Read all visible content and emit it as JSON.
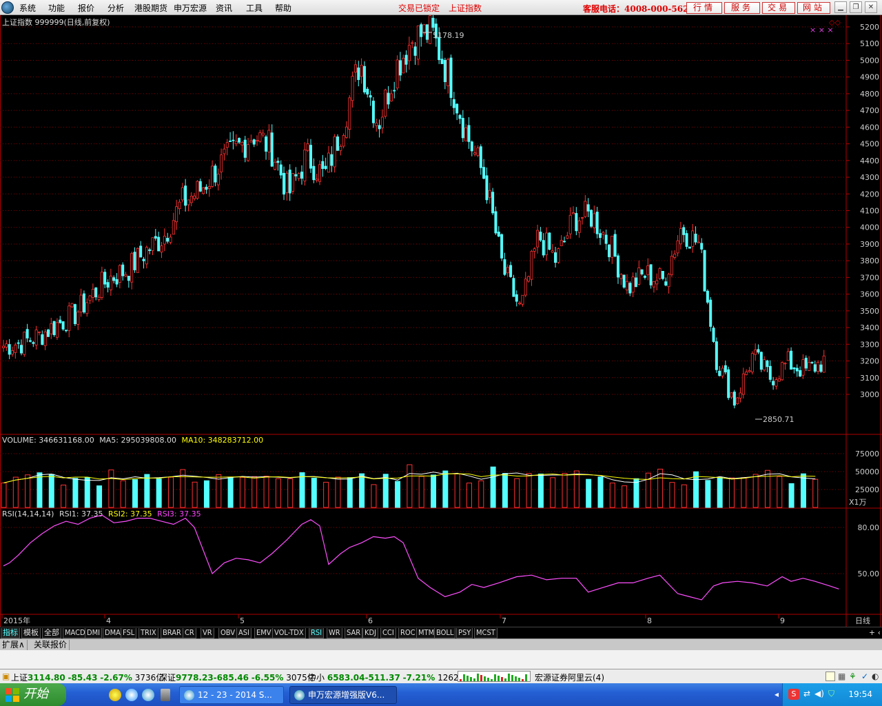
{
  "menu": {
    "items": [
      "系统",
      "功能",
      "报价",
      "分析",
      "港股期货",
      "申万宏源",
      "资讯",
      "工具",
      "帮助"
    ],
    "status1": "交易已锁定",
    "status2": "上证指数",
    "service_phone": "客服电话：4008-000-562",
    "buttons": [
      "行情",
      "服务",
      "交易",
      "网站"
    ]
  },
  "chart_data": [
    {
      "type": "candlestick",
      "title": "上证指数 999999(日线,前复权)",
      "ylim": [
        2800,
        5250
      ],
      "yticks": [
        3000,
        3100,
        3200,
        3300,
        3400,
        3500,
        3600,
        3700,
        3800,
        3900,
        4000,
        4100,
        4200,
        4300,
        4400,
        4500,
        4600,
        4700,
        4800,
        4900,
        5000,
        5100,
        5200
      ],
      "high_label": "5178.19",
      "low_label": "2850.71",
      "x_labels": [
        "2015年",
        "4",
        "5",
        "6",
        "7",
        "8",
        "9"
      ],
      "period_label": "日线",
      "anchors": [
        [
          3290,
          3290
        ],
        [
          3300,
          3310
        ],
        [
          3330,
          3350
        ],
        [
          3390,
          3420
        ],
        [
          3500,
          3480
        ],
        [
          3580,
          3600
        ],
        [
          3650,
          3700
        ],
        [
          3690,
          3750
        ],
        [
          3800,
          3860
        ],
        [
          3920,
          3950
        ],
        [
          4080,
          4150
        ],
        [
          4170,
          4220
        ],
        [
          4290,
          4360
        ],
        [
          4400,
          4460
        ],
        [
          4530,
          4560
        ],
        [
          4420,
          4480
        ],
        [
          4120,
          4200
        ],
        [
          4400,
          4430
        ],
        [
          4300,
          4300
        ],
        [
          4560,
          4610
        ],
        [
          4960,
          5000
        ],
        [
          4630,
          4620
        ],
        [
          4900,
          4960
        ],
        [
          5130,
          5140
        ],
        [
          5140,
          5170
        ],
        [
          4900,
          4900
        ],
        [
          4480,
          4550
        ],
        [
          4180,
          4290
        ],
        [
          3690,
          3750
        ],
        [
          3510,
          3500
        ],
        [
          3890,
          3950
        ],
        [
          3760,
          3800
        ],
        [
          4040,
          4060
        ],
        [
          3990,
          4070
        ],
        [
          4000,
          3900
        ],
        [
          3720,
          3640
        ],
        [
          3760,
          3720
        ],
        [
          3680,
          3680
        ],
        [
          3980,
          4000
        ],
        [
          3980,
          3900
        ],
        [
          3280,
          3200
        ],
        [
          3000,
          2960
        ],
        [
          3020,
          3230
        ],
        [
          3060,
          3100
        ],
        [
          3160,
          3190
        ],
        [
          3160,
          3140
        ],
        [
          3200,
          3200
        ]
      ],
      "volume": {
        "label": "VOLUME: 346631168.00",
        "ma5": "MA5: 295039808.00",
        "ma10": "MA10: 348283712.00",
        "yticks": [
          25000,
          50000,
          75000
        ],
        "unit": "X1万"
      },
      "rsi": {
        "label": "RSI(14,14,14)",
        "rsi1": "RSI1: 37.35",
        "rsi2": "RSI2: 37.35",
        "rsi3": "RSI3: 37.35",
        "yticks": [
          50,
          80
        ],
        "anchors": [
          [
            0,
            55
          ],
          [
            2,
            57
          ],
          [
            5,
            62
          ],
          [
            9,
            70
          ],
          [
            13,
            76
          ],
          [
            17,
            81
          ],
          [
            21,
            84
          ],
          [
            25,
            82
          ],
          [
            29,
            86
          ],
          [
            33,
            88
          ],
          [
            37,
            83
          ],
          [
            41,
            84
          ],
          [
            45,
            86
          ],
          [
            49,
            86
          ],
          [
            53,
            84
          ],
          [
            57,
            82
          ],
          [
            61,
            86
          ],
          [
            64,
            80
          ],
          [
            70,
            50
          ],
          [
            74,
            57
          ],
          [
            78,
            60
          ],
          [
            82,
            59
          ],
          [
            86,
            57
          ],
          [
            90,
            63
          ],
          [
            95,
            72
          ],
          [
            100,
            82
          ],
          [
            103,
            85
          ],
          [
            106,
            81
          ],
          [
            109,
            56
          ],
          [
            113,
            63
          ],
          [
            116,
            67
          ],
          [
            120,
            70
          ],
          [
            124,
            74
          ],
          [
            128,
            73
          ],
          [
            131,
            74
          ],
          [
            134,
            70
          ],
          [
            139,
            47
          ],
          [
            143,
            41
          ],
          [
            148,
            35
          ],
          [
            153,
            38
          ],
          [
            157,
            43
          ],
          [
            161,
            41
          ],
          [
            166,
            44
          ],
          [
            172,
            48
          ],
          [
            177,
            49
          ],
          [
            182,
            46
          ],
          [
            187,
            47
          ],
          [
            192,
            47
          ],
          [
            196,
            38
          ],
          [
            201,
            41
          ],
          [
            206,
            44
          ],
          [
            211,
            44
          ],
          [
            216,
            47
          ],
          [
            220,
            49
          ],
          [
            226,
            37
          ],
          [
            230,
            35
          ],
          [
            234,
            33
          ],
          [
            238,
            42
          ],
          [
            241,
            44
          ],
          [
            246,
            45
          ],
          [
            251,
            44
          ],
          [
            256,
            42
          ],
          [
            261,
            48
          ],
          [
            264,
            45
          ],
          [
            268,
            47
          ],
          [
            272,
            45
          ],
          [
            277,
            42
          ],
          [
            280,
            40
          ]
        ]
      }
    }
  ],
  "indicator_tabs": [
    "指标",
    "模板",
    "全部",
    "MACD",
    "DMI",
    "DMA",
    "FSL",
    "TRIX",
    "BRAR",
    "CR",
    "VR",
    "OBV",
    "ASI",
    "EMV",
    "VOL-TDX",
    "RSI",
    "WR",
    "SAR",
    "KDJ",
    "CCI",
    "ROC",
    "MTM",
    "BOLL",
    "PSY",
    "MCST"
  ],
  "ext_tabs": [
    "扩展∧",
    "关联报价"
  ],
  "status": {
    "sh_name": "上证",
    "sh_value": "3114.80",
    "sh_change": "-85.43",
    "sh_pct": "-2.67%",
    "sh_amount": "3736亿",
    "sz_name": "深证",
    "sz_value": "9778.23",
    "sz_change": "-685.46",
    "sz_pct": "-6.55%",
    "sz_amount": "3075亿",
    "zx_name": "中小",
    "zx_value": "6583.04",
    "zx_change": "-511.37",
    "zx_pct": "-7.21%",
    "zx_amount": "1262亿",
    "ticker": "宏源证券阿里云(4)"
  },
  "taskbar": {
    "start": "开始",
    "tasks": [
      "12 - 23 - 2014 S...",
      "申万宏源增强版V6..."
    ],
    "clock": "19:54"
  },
  "colors": {
    "up": "#ff3232",
    "down": "#54ffff",
    "bg": "#000000",
    "rsi": "#ff4fff",
    "ma5": "#ffffff",
    "ma10": "#ffff00"
  }
}
